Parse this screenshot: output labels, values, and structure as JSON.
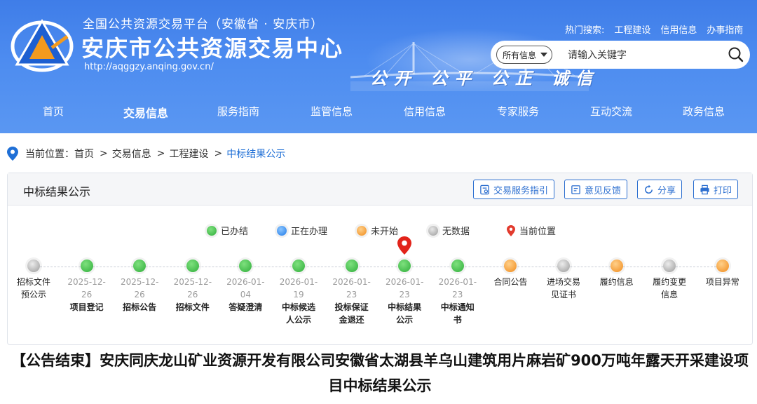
{
  "header": {
    "platform_line": "全国公共资源交易平台（安徽省 · 安庆市）",
    "site_title": "安庆市公共资源交易中心",
    "site_url": "http://aqggzy.anqing.gov.cn/",
    "slogan": "公开 公平 公正 诚信",
    "hot_label": "热门搜索:",
    "hot_links": [
      "工程建设",
      "信用信息",
      "办事指南"
    ],
    "search_scope": "所有信息",
    "search_placeholder": "请输入关键字",
    "nav": [
      "首页",
      "交易信息",
      "服务指南",
      "监管信息",
      "信用信息",
      "专家服务",
      "互动交流",
      "政务信息"
    ],
    "nav_active": "交易信息",
    "colors": {
      "header_blue": "#4a88ef",
      "accent": "#1f6fd6"
    }
  },
  "breadcrumb": {
    "label": "当前位置：",
    "items": [
      "首页",
      "交易信息",
      "工程建设"
    ],
    "current": "中标结果公示"
  },
  "panel": {
    "title": "中标结果公示",
    "tools": [
      {
        "label": "交易服务指引",
        "icon": "guide-icon"
      },
      {
        "label": "意见反馈",
        "icon": "feedback-icon"
      },
      {
        "label": "分享",
        "icon": "share-icon"
      },
      {
        "label": "打印",
        "icon": "print-icon"
      }
    ],
    "legend": [
      {
        "label": "已办结",
        "status": "green"
      },
      {
        "label": "正在办理",
        "status": "blue"
      },
      {
        "label": "未开始",
        "status": "orange"
      },
      {
        "label": "无数据",
        "status": "gray"
      },
      {
        "label": "当前位置",
        "status": "pin"
      }
    ],
    "steps": [
      {
        "date": "",
        "label": "招标文件预公示",
        "status": "gray"
      },
      {
        "date": "2025-12-26",
        "label": "项目登记",
        "status": "green"
      },
      {
        "date": "2025-12-26",
        "label": "招标公告",
        "status": "green"
      },
      {
        "date": "2025-12-26",
        "label": "招标文件",
        "status": "green"
      },
      {
        "date": "2026-01-04",
        "label": "答疑澄清",
        "status": "green"
      },
      {
        "date": "2026-01-19",
        "label": "中标候选人公示",
        "status": "green"
      },
      {
        "date": "2026-01-23",
        "label": "投标保证金退还",
        "status": "green"
      },
      {
        "date": "2026-01-23",
        "label": "中标结果公示",
        "status": "green",
        "current": true
      },
      {
        "date": "2026-01-23",
        "label": "中标通知书",
        "status": "green"
      },
      {
        "date": "",
        "label": "合同公告",
        "status": "orange"
      },
      {
        "date": "",
        "label": "进场交易见证书",
        "status": "gray"
      },
      {
        "date": "",
        "label": "履约信息",
        "status": "orange"
      },
      {
        "date": "",
        "label": "履约变更信息",
        "status": "gray"
      },
      {
        "date": "",
        "label": "项目异常",
        "status": "orange"
      }
    ]
  },
  "headline": "【公告结束】安庆同庆龙山矿业资源开发有限公司安徽省太湖县羊乌山建筑用片麻岩矿900万吨年露天开采建设项目中标结果公示"
}
